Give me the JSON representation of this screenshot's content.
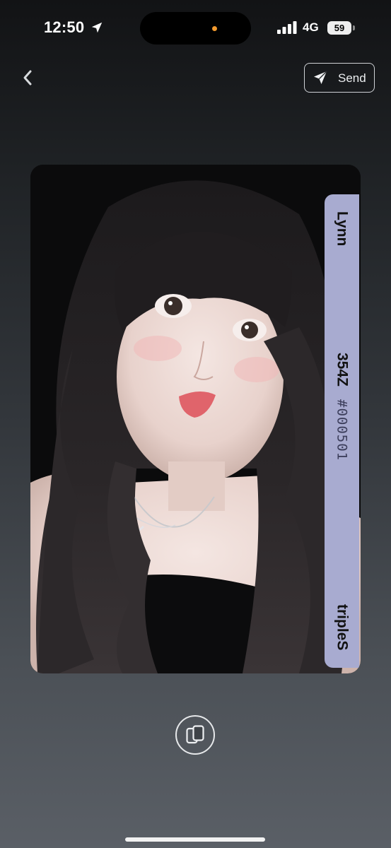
{
  "status_bar": {
    "time": "12:50",
    "network": "4G",
    "battery": "59"
  },
  "header": {
    "send_label": "Send"
  },
  "card": {
    "member_name": "Lynn",
    "collection_no": "354Z",
    "serial_no": "#000501",
    "group_name": "tripleS",
    "band_color": "#a8abd0"
  },
  "colors": {
    "island_dot": "#f29a2e",
    "button_outline": "#cfd2d6"
  },
  "icons": {
    "back": "chevron-left-icon",
    "send": "paper-plane-icon",
    "flip": "flip-card-icon",
    "location": "location-arrow-icon"
  }
}
